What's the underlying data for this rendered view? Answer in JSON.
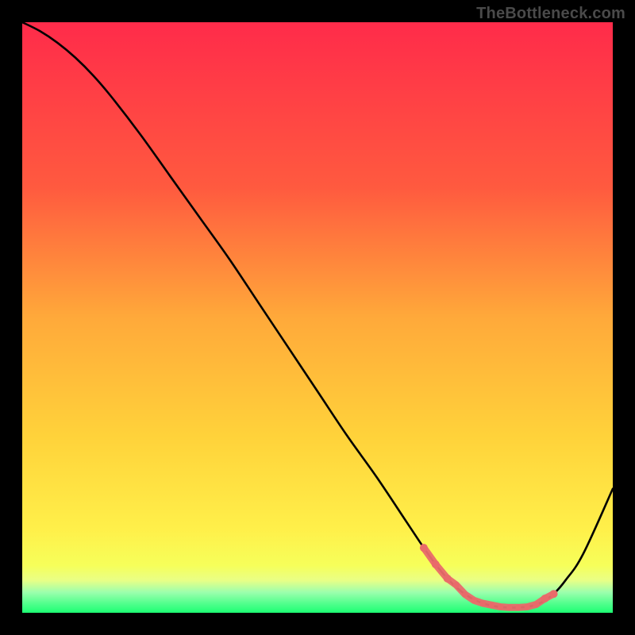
{
  "watermark": "TheBottleneck.com",
  "colors": {
    "gradient_top": "#ff2b4a",
    "gradient_mid_upper": "#ff7a3d",
    "gradient_mid": "#ffd23a",
    "gradient_low": "#f6ff5a",
    "gradient_band_top": "#e9ff86",
    "gradient_band_mid": "#9dffad",
    "gradient_bottom": "#1eff73",
    "curve": "#000000",
    "marker_fill": "#e96a6a",
    "marker_stroke": "#e96a6a"
  },
  "chart_data": {
    "type": "line",
    "title": "",
    "xlabel": "",
    "ylabel": "",
    "xlim": [
      0,
      100
    ],
    "ylim": [
      0,
      100
    ],
    "grid": false,
    "series": [
      {
        "name": "bottleneck-curve",
        "x": [
          0,
          3,
          6,
          9,
          12,
          15,
          20,
          25,
          30,
          35,
          40,
          45,
          50,
          55,
          60,
          65,
          68,
          70,
          72,
          74,
          76,
          78,
          80,
          82,
          84,
          86,
          88,
          90,
          92,
          95,
          100
        ],
        "y": [
          100,
          98.5,
          96.5,
          94,
          91,
          87.5,
          81,
          74,
          67,
          60,
          52.5,
          45,
          37.5,
          30,
          23,
          15.5,
          11,
          8.2,
          5.8,
          3.9,
          2.5,
          1.6,
          1.1,
          0.9,
          0.9,
          1.1,
          1.8,
          3.2,
          5.5,
          10,
          21
        ]
      }
    ],
    "highlight_markers": {
      "x": [
        68,
        70,
        72,
        73.5,
        75,
        76.5,
        78,
        79.5,
        81,
        82.5,
        84,
        85.5,
        87,
        88.5,
        90
      ],
      "y": [
        11,
        8.2,
        5.8,
        4.7,
        3.1,
        2.1,
        1.6,
        1.3,
        1.0,
        0.9,
        0.9,
        1.0,
        1.4,
        2.4,
        3.2
      ],
      "size": [
        5,
        5,
        5,
        4,
        3.5,
        3.5,
        3.5,
        3.5,
        3.5,
        3.5,
        3.5,
        3.5,
        4,
        5,
        5
      ]
    }
  }
}
